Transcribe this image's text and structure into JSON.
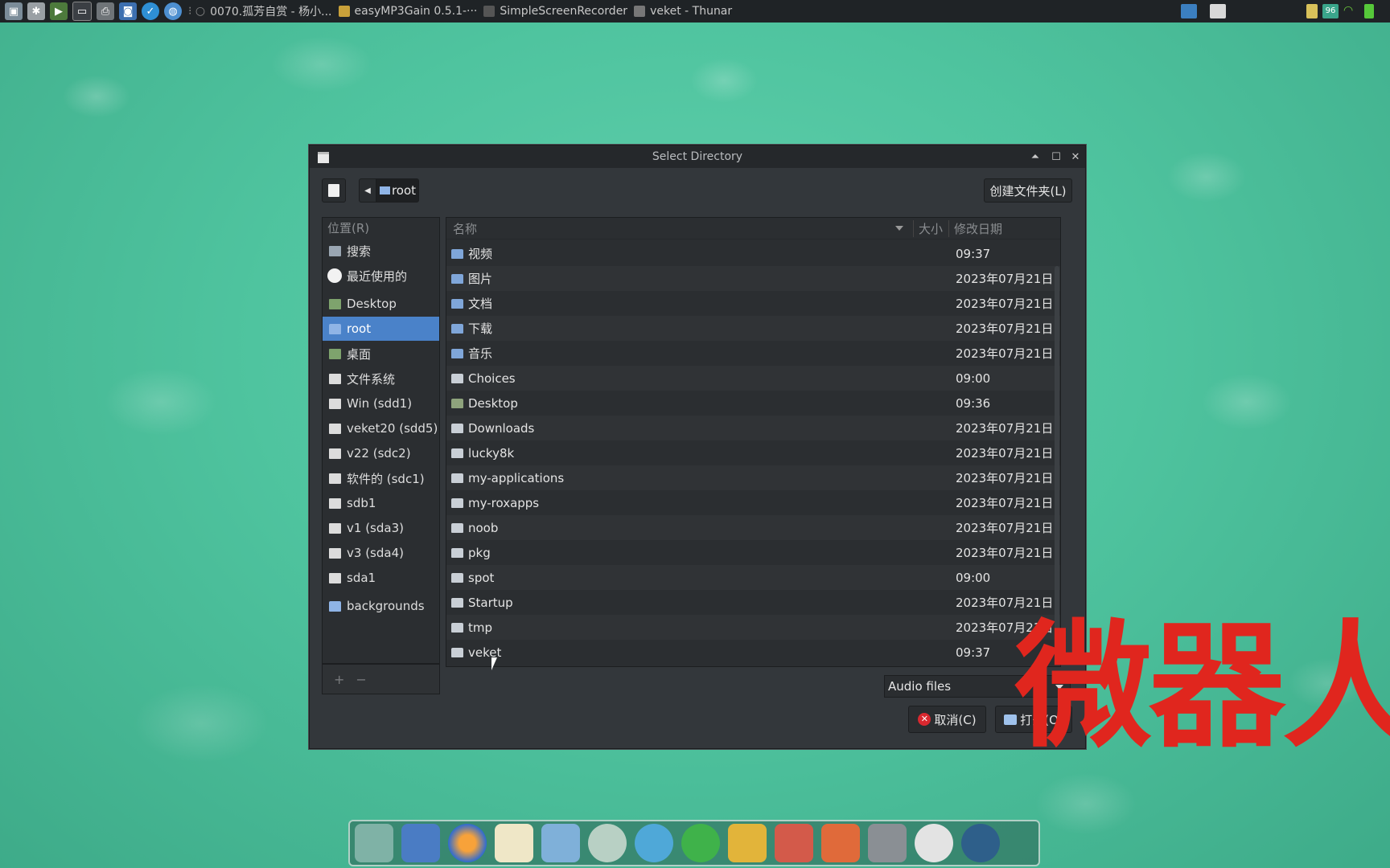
{
  "taskbar": {
    "tasks": [
      {
        "label": "0070.孤芳自赏 - 杨小..."
      },
      {
        "label": "easyMP3Gain 0.5.1-···"
      },
      {
        "label": "SimpleScreenRecorder"
      },
      {
        "label": "veket - Thunar"
      }
    ],
    "battery": "96"
  },
  "dialog": {
    "title": "Select Directory",
    "path_button": "root",
    "create_folder": "创建文件夹(L)",
    "places_header": "位置(R)",
    "places": [
      {
        "label": "搜索",
        "icon": "search-icon"
      },
      {
        "label": "最近使用的",
        "icon": "clock-icon"
      },
      {
        "label": "Desktop",
        "icon": "desktop-icon"
      },
      {
        "label": "root",
        "icon": "folder-icon",
        "selected": true
      },
      {
        "label": "桌面",
        "icon": "desktop-icon"
      },
      {
        "label": "文件系统",
        "icon": "drive-icon"
      },
      {
        "label": "Win (sdd1)",
        "icon": "drive-icon"
      },
      {
        "label": "veket20 (sdd5)",
        "icon": "drive-icon"
      },
      {
        "label": "v22 (sdc2)",
        "icon": "drive-icon"
      },
      {
        "label": "软件的 (sdc1)",
        "icon": "drive-icon"
      },
      {
        "label": "sdb1",
        "icon": "drive-icon"
      },
      {
        "label": "v1 (sda3)",
        "icon": "drive-icon"
      },
      {
        "label": "v3 (sda4)",
        "icon": "drive-icon"
      },
      {
        "label": "sda1",
        "icon": "drive-icon"
      },
      {
        "label": "backgrounds",
        "icon": "folder-icon"
      }
    ],
    "places_add": "+",
    "places_remove": "−",
    "columns": {
      "name": "名称",
      "size": "大小",
      "modified": "修改日期"
    },
    "files": [
      {
        "name": "视频",
        "date": "09:37"
      },
      {
        "name": "图片",
        "date": "2023年07月21日"
      },
      {
        "name": "文档",
        "date": "2023年07月21日"
      },
      {
        "name": "下载",
        "date": "2023年07月21日"
      },
      {
        "name": "音乐",
        "date": "2023年07月21日"
      },
      {
        "name": "Choices",
        "date": "09:00"
      },
      {
        "name": "Desktop",
        "date": "09:36"
      },
      {
        "name": "Downloads",
        "date": "2023年07月21日"
      },
      {
        "name": "lucky8k",
        "date": "2023年07月21日"
      },
      {
        "name": "my-applications",
        "date": "2023年07月21日"
      },
      {
        "name": "my-roxapps",
        "date": "2023年07月21日"
      },
      {
        "name": "noob",
        "date": "2023年07月21日"
      },
      {
        "name": "pkg",
        "date": "2023年07月21日"
      },
      {
        "name": "spot",
        "date": "09:00"
      },
      {
        "name": "Startup",
        "date": "2023年07月21日"
      },
      {
        "name": "tmp",
        "date": "2023年07月21日"
      },
      {
        "name": "veket",
        "date": "09:37"
      }
    ],
    "filter": "Audio files",
    "cancel": "取消(C)",
    "open": "打开(O)"
  },
  "overlay_text": "微器人",
  "colors": {
    "selection": "#4a82c9",
    "overlay_red": "#e0261e",
    "desktop": "#4fc49f"
  }
}
